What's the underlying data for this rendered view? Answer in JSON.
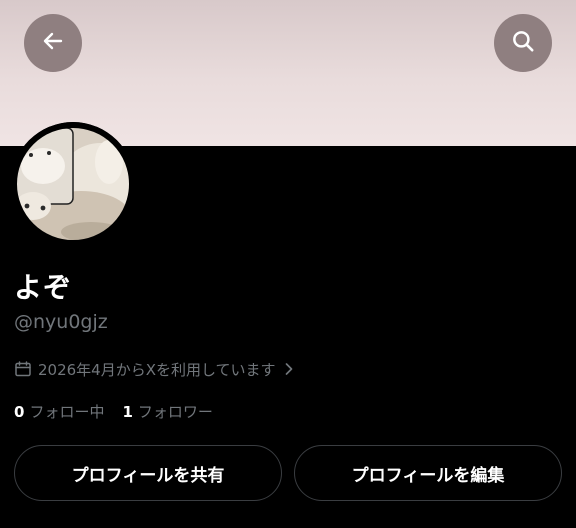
{
  "header": {
    "back_icon": "arrow-left-icon",
    "search_icon": "search-icon",
    "banner_color": "#e9dcdc"
  },
  "profile": {
    "display_name": "よぞ",
    "handle": "@nyu0gjz",
    "joined": "2026年4月からXを利用しています",
    "following_count": "0",
    "following_label": "フォロー中",
    "followers_count": "1",
    "followers_label": "フォロワー"
  },
  "actions": {
    "share_label": "プロフィールを共有",
    "edit_label": "プロフィールを編集"
  }
}
